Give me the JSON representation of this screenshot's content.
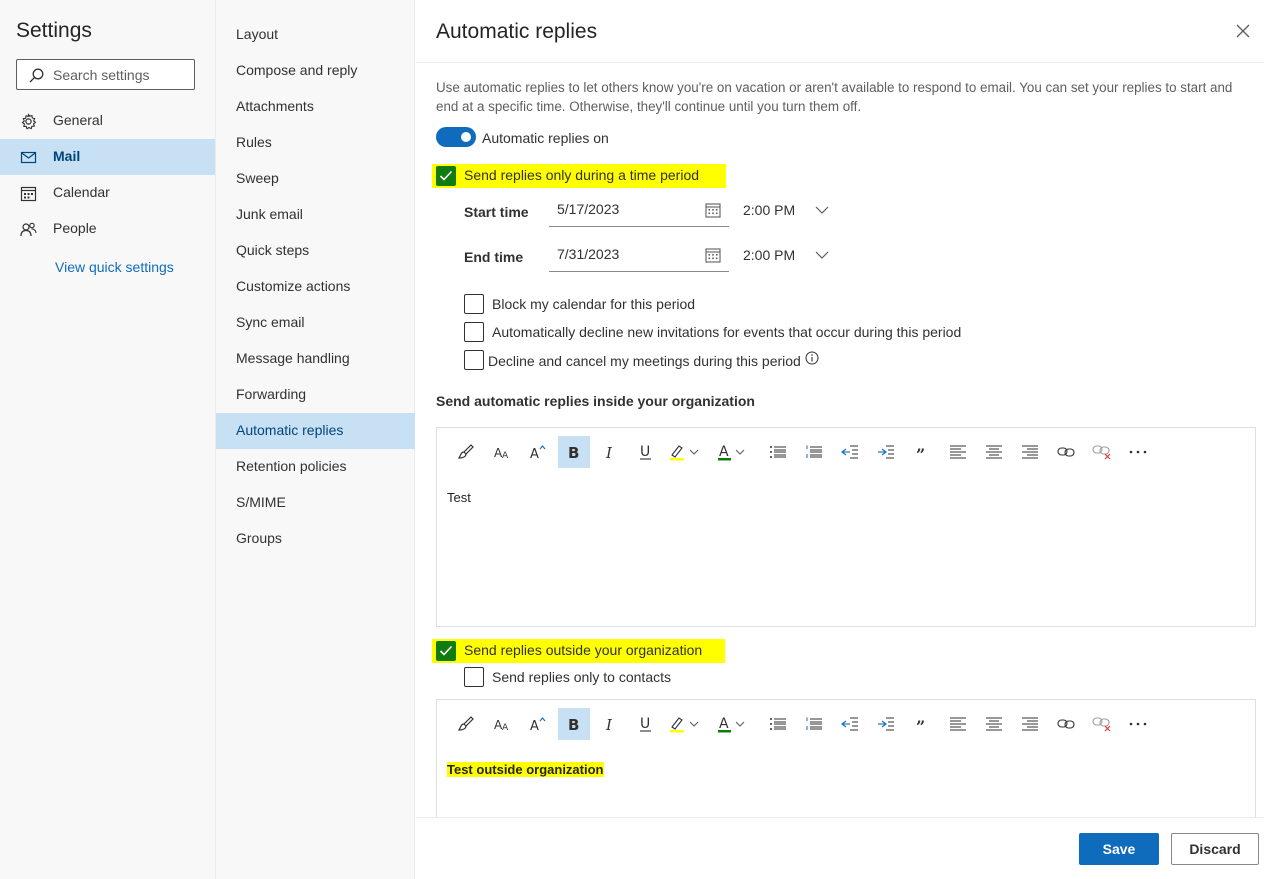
{
  "settings": {
    "title": "Settings",
    "search_placeholder": "Search settings",
    "nav": [
      {
        "label": "General",
        "icon": "gear-icon"
      },
      {
        "label": "Mail",
        "icon": "mail-icon",
        "selected": true
      },
      {
        "label": "Calendar",
        "icon": "calendar-icon"
      },
      {
        "label": "People",
        "icon": "people-icon"
      }
    ],
    "view_quick_settings": "View quick settings"
  },
  "mail_nav": [
    "Layout",
    "Compose and reply",
    "Attachments",
    "Rules",
    "Sweep",
    "Junk email",
    "Quick steps",
    "Customize actions",
    "Sync email",
    "Message handling",
    "Forwarding",
    "Automatic replies",
    "Retention policies",
    "S/MIME",
    "Groups"
  ],
  "mail_nav_selected": "Automatic replies",
  "panel": {
    "title": "Automatic replies",
    "description": "Use automatic replies to let others know you're on vacation or aren't available to respond to email. You can set your replies to start and end at a specific time. Otherwise, they'll continue until you turn them off.",
    "toggle_label": "Automatic replies on",
    "toggle_on": true,
    "time_period_label": "Send replies only during a time period",
    "time_period_checked": true,
    "start_time_label": "Start time",
    "start_date": "5/17/2023",
    "start_time": "2:00 PM",
    "end_time_label": "End time",
    "end_date": "7/31/2023",
    "end_time": "2:00 PM",
    "options": [
      {
        "label": "Block my calendar for this period",
        "checked": false
      },
      {
        "label": "Automatically decline new invitations for events that occur during this period",
        "checked": false
      },
      {
        "label": "Decline and cancel my meetings during this period",
        "checked": false
      }
    ],
    "inside_heading": "Send automatic replies inside your organization",
    "inside_body": "Test",
    "outside_label": "Send replies outside your organization",
    "outside_checked": true,
    "contacts_only_label": "Send replies only to contacts",
    "contacts_only_checked": false,
    "outside_body": "Test outside organization"
  },
  "footer": {
    "save_label": "Save",
    "discard_label": "Discard"
  },
  "colors": {
    "accent": "#0f6cbd",
    "selected_bg": "#c7e0f4",
    "highlight": "#ffff00",
    "check_green": "#107c10"
  }
}
